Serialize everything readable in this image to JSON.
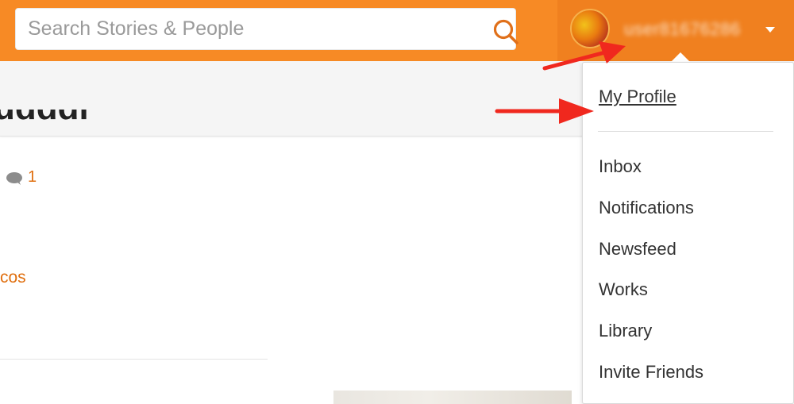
{
  "search": {
    "placeholder": "Search Stories & People"
  },
  "user": {
    "username": "user81676286"
  },
  "content": {
    "title_fragment": "udddi",
    "comment_count": "1",
    "link_fragment": "cos"
  },
  "menu": {
    "items": [
      {
        "label": "My Profile"
      },
      {
        "label": "Inbox"
      },
      {
        "label": "Notifications"
      },
      {
        "label": "Newsfeed"
      },
      {
        "label": "Works"
      },
      {
        "label": "Library"
      },
      {
        "label": "Invite Friends"
      }
    ]
  },
  "colors": {
    "topbar": "#f78a25",
    "accent": "#e06f0f",
    "annotation_arrow": "#f0281e"
  },
  "icons": {
    "search": "search-icon",
    "dropdown": "caret-down-icon",
    "comment": "comment-icon"
  }
}
